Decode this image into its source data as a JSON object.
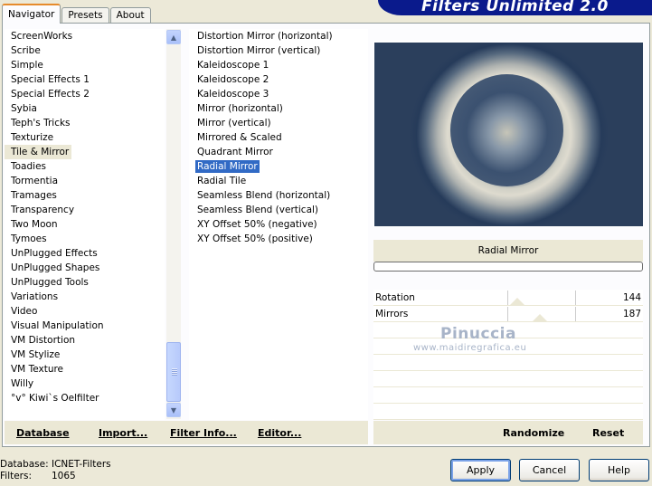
{
  "tabs": [
    "Navigator",
    "Presets",
    "About"
  ],
  "app_title": "Filters Unlimited 2.0",
  "categories": [
    "ScreenWorks",
    "Scribe",
    "Simple",
    "Special Effects 1",
    "Special Effects 2",
    "Sybia",
    "Teph's Tricks",
    "Texturize",
    "Tile & Mirror",
    "Toadies",
    "Tormentia",
    "Tramages",
    "Transparency",
    "Two Moon",
    "Tymoes",
    "UnPlugged Effects",
    "UnPlugged Shapes",
    "UnPlugged Tools",
    "Variations",
    "Video",
    "Visual Manipulation",
    "VM Distortion",
    "VM Stylize",
    "VM Texture",
    "Willy",
    "°v° Kiwi`s Oelfilter"
  ],
  "selected_category": "Tile & Mirror",
  "filters": [
    "Distortion Mirror (horizontal)",
    "Distortion Mirror (vertical)",
    "Kaleidoscope 1",
    "Kaleidoscope 2",
    "Kaleidoscope 3",
    "Mirror (horizontal)",
    "Mirror (vertical)",
    "Mirrored & Scaled",
    "Quadrant Mirror",
    "Radial Mirror",
    "Radial Tile",
    "Seamless Blend (horizontal)",
    "Seamless Blend (vertical)",
    "XY Offset 50% (negative)",
    "XY Offset 50% (positive)"
  ],
  "selected_filter": "Radial Mirror",
  "left_buttons": {
    "database": "Database",
    "import": "Import...",
    "filter_info": "Filter Info...",
    "editor": "Editor..."
  },
  "filter_title": "Radial Mirror",
  "params": [
    {
      "name": "Rotation",
      "value": "144",
      "level": 144
    },
    {
      "name": "Mirrors",
      "value": "187",
      "level": 187
    }
  ],
  "param_max": 255,
  "right_buttons": {
    "randomize": "Randomize",
    "reset": "Reset"
  },
  "watermark": {
    "title": "Pinuccia",
    "url": "www.maidiregrafica.eu"
  },
  "footer": {
    "database_label": "Database:",
    "database_value": "ICNET-Filters",
    "filters_label": "Filters:",
    "filters_value": "1065"
  },
  "dialog_buttons": {
    "apply": "Apply",
    "cancel": "Cancel",
    "help": "Help"
  },
  "colors": {
    "banner": "#0a1a8c",
    "selection": "#316ac5"
  }
}
